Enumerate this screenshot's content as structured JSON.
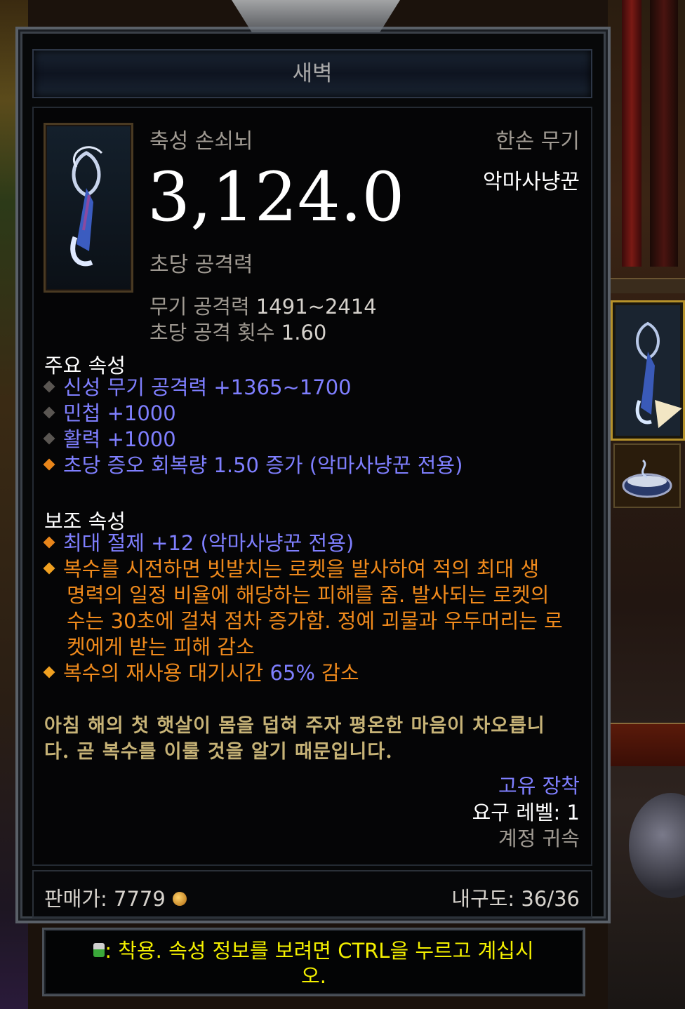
{
  "item": {
    "name": "새벽",
    "type": "축성 손쇠뇌",
    "slot_type": "한손 무기",
    "class": "악마사냥꾼",
    "dps_value": "3,124.0",
    "dps_label": "초당 공격력",
    "weapon_damage_label": "무기 공격력",
    "weapon_damage_value": "1491~2414",
    "attack_speed_label": "초당 공격 횟수",
    "attack_speed_value": "1.60",
    "icon": "hand-crossbow-icon"
  },
  "primary": {
    "header": "주요 속성",
    "lines": [
      "신성 무기 공격력 +1365~1700",
      "민첩 +1000",
      "활력 +1000",
      "초당 증오 회복량 1.50 증가 (악마사냥꾼 전용)"
    ]
  },
  "secondary": {
    "header": "보조 속성",
    "line1": "최대 절제 +12 (악마사냥꾼 전용)",
    "legendary_lines": [
      "복수를 시전하면 빗발치는 로켓을 발사하여 적의 최대 생",
      "명력의 일정 비율에 해당하는 피해를 줌. 발사되는 로켓의",
      "수는 30초에 걸쳐 점차 증가함. 정예 괴물과 우두머리는 로",
      "켓에게 받는 피해 감소"
    ],
    "cdr_prefix": "복수의 재사용 대기시간 ",
    "cdr_value": "65%",
    "cdr_suffix": " 감소"
  },
  "flavor": [
    "아침 해의 첫 햇살이 몸을 덥혀 주자 평온한 마음이 차오릅니",
    "다. 곧 복수를 이룰 것을 알기 때문입니다."
  ],
  "footer": {
    "rarity": "고유 장착",
    "level_label": "요구 레벨:",
    "level_value": "1",
    "bound": "계정 귀속",
    "sell_label": "판매가:",
    "sell_value": "7779",
    "durability_label": "내구도:",
    "durability_value": "36/36"
  },
  "hint": {
    "line1": ": 착용. 속성 정보를 보려면 CTRL을 누르고 계십시",
    "line2": "오."
  },
  "colors": {
    "blue_stat": "#7f7fff",
    "orange_stat": "#f08a1c",
    "flavor": "#c7b377",
    "hint": "#f4f000"
  }
}
